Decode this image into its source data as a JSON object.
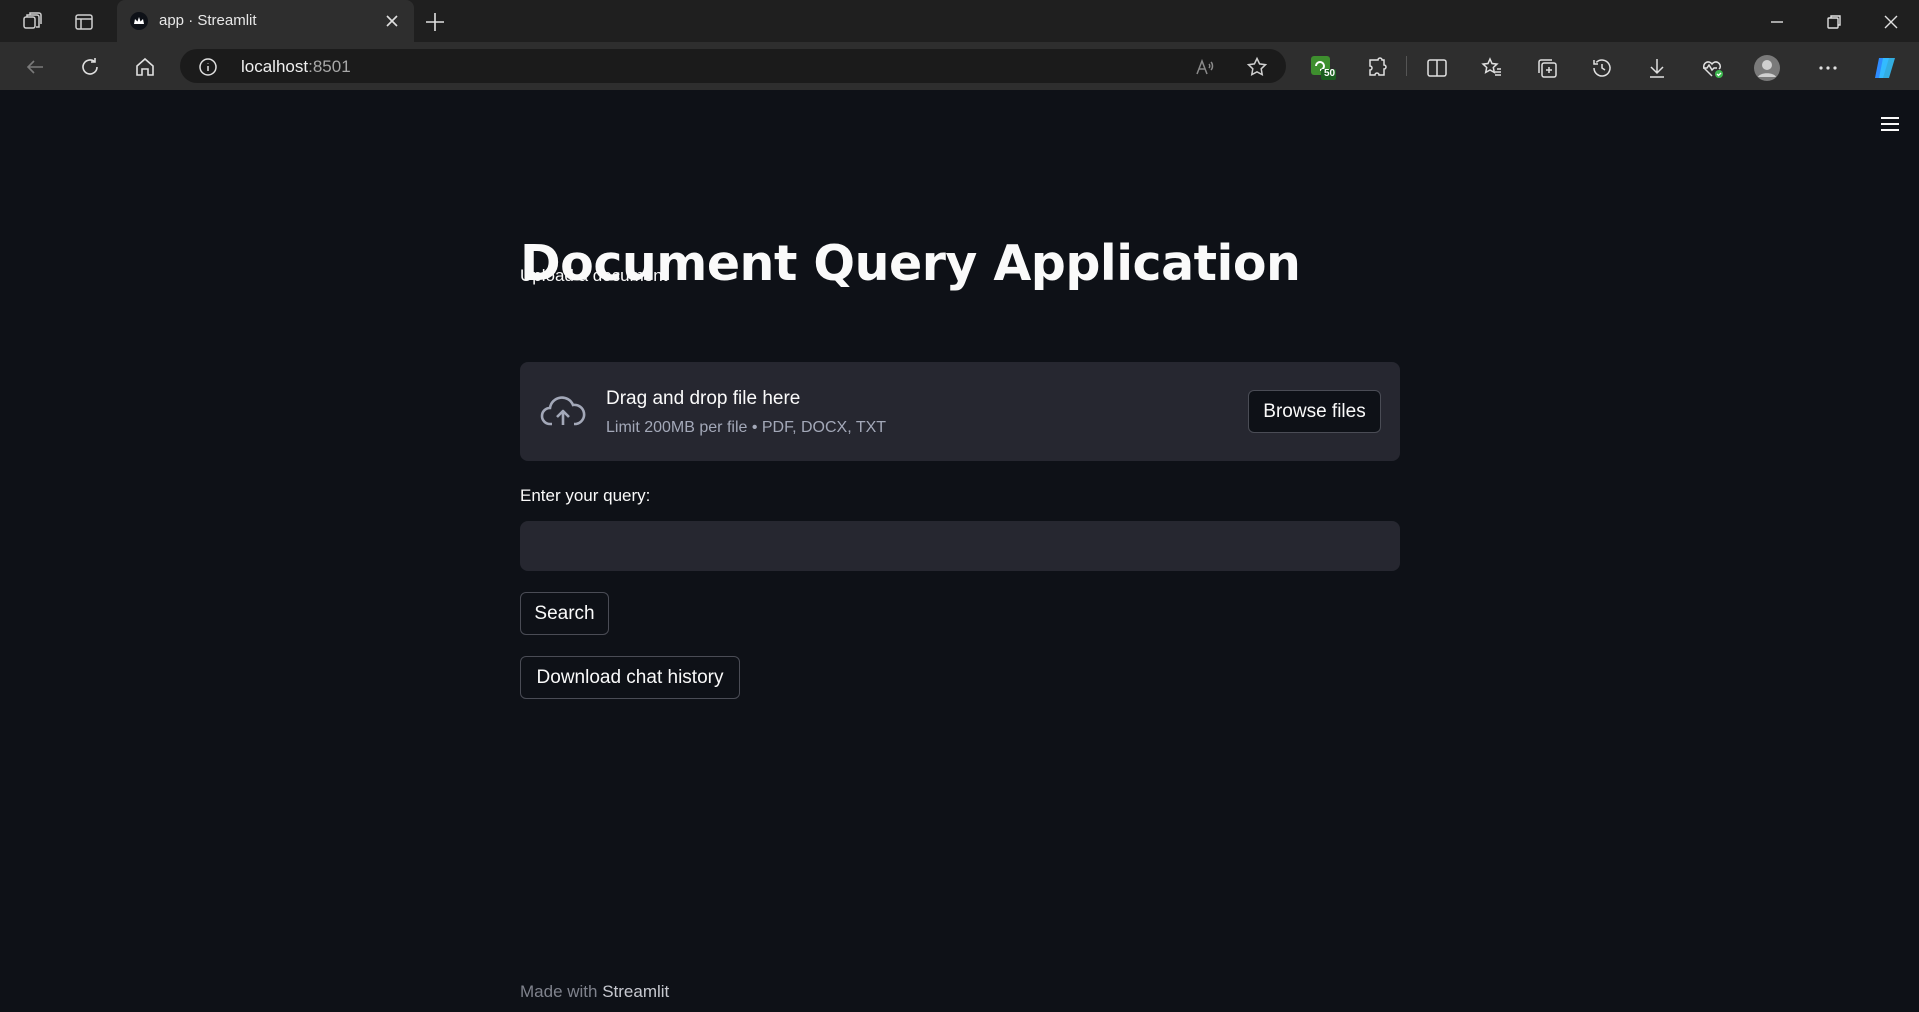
{
  "browser": {
    "tab_title": "app · Streamlit",
    "address_host": "localhost",
    "address_port": ":8501",
    "extension_badge": "50"
  },
  "app": {
    "title": "Document Query Application",
    "upload_label": "Upload a document",
    "drop_title": "Drag and drop file here",
    "drop_subtitle": "Limit 200MB per file • PDF, DOCX, TXT",
    "browse_label": "Browse files",
    "query_label": "Enter your query:",
    "query_value": "",
    "search_label": "Search",
    "download_label": "Download chat history"
  },
  "footer": {
    "prefix": "Made with ",
    "brand": "Streamlit"
  },
  "colors": {
    "background": "#0e1117",
    "surface": "#262730",
    "accent_red": "#ff4b4b"
  }
}
